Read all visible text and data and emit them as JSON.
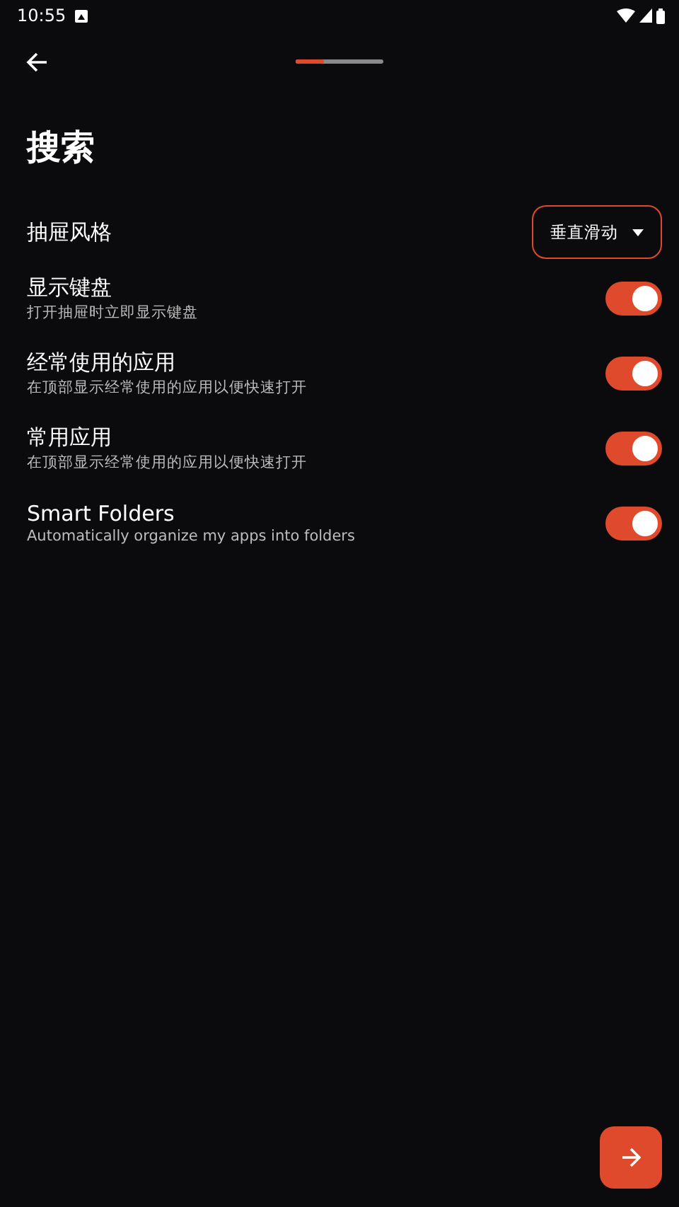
{
  "status_bar": {
    "time": "10:55"
  },
  "progress": {
    "level": 0.33
  },
  "title": "搜索",
  "dropdown_setting": {
    "label": "抽屉风格",
    "value": "垂直滑动"
  },
  "toggles": [
    {
      "title": "显示键盘",
      "subtitle": "打开抽屉时立即显示键盘",
      "on": true
    },
    {
      "title": "经常使用的应用",
      "subtitle": "在顶部显示经常使用的应用以便快速打开",
      "on": true
    },
    {
      "title": "常用应用",
      "subtitle": "在顶部显示经常使用的应用以便快速打开",
      "on": true
    },
    {
      "title": "Smart Folders",
      "subtitle": "Automatically organize my apps into folders",
      "on": true
    }
  ]
}
